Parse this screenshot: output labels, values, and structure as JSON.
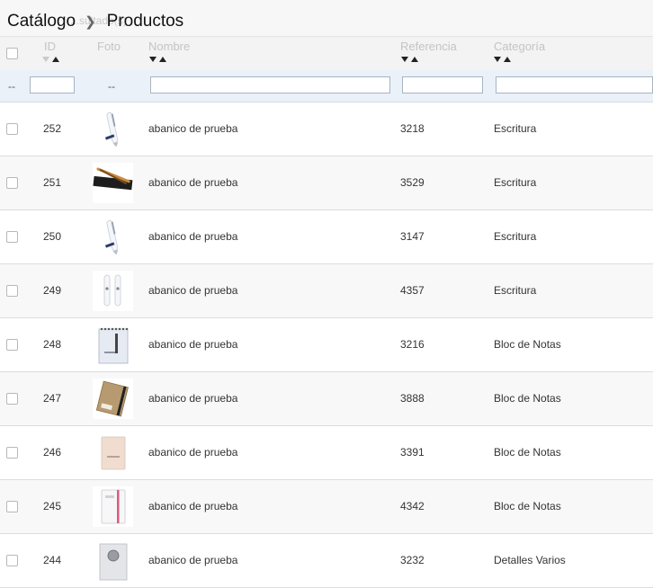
{
  "breadcrumb": {
    "parent": "Catálogo",
    "current": "Productos"
  },
  "list_info": {
    "count_text": "...sultado(s)"
  },
  "columns": {
    "id": "ID",
    "photo": "Foto",
    "name": "Nombre",
    "reference": "Referencia",
    "category": "Categoría"
  },
  "filters": {
    "id_dash": "--",
    "photo_dash": "--"
  },
  "products": [
    {
      "id": "252",
      "name": "abanico de prueba",
      "reference": "3218",
      "category": "Escritura",
      "thumb": "pen-white"
    },
    {
      "id": "251",
      "name": "abanico de prueba",
      "reference": "3529",
      "category": "Escritura",
      "thumb": "pen-set-black-box"
    },
    {
      "id": "250",
      "name": "abanico de prueba",
      "reference": "3147",
      "category": "Escritura",
      "thumb": "pen-white"
    },
    {
      "id": "249",
      "name": "abanico de prueba",
      "reference": "4357",
      "category": "Escritura",
      "thumb": "pen-pair"
    },
    {
      "id": "248",
      "name": "abanico de prueba",
      "reference": "3216",
      "category": "Bloc de Notas",
      "thumb": "spiral-notepad"
    },
    {
      "id": "247",
      "name": "abanico de prueba",
      "reference": "3888",
      "category": "Bloc de Notas",
      "thumb": "kraft-notebook"
    },
    {
      "id": "246",
      "name": "abanico de prueba",
      "reference": "3391",
      "category": "Bloc de Notas",
      "thumb": "beige-notebook"
    },
    {
      "id": "245",
      "name": "abanico de prueba",
      "reference": "4342",
      "category": "Bloc de Notas",
      "thumb": "white-notebook-pink-band"
    },
    {
      "id": "244",
      "name": "abanico de prueba",
      "reference": "3232",
      "category": "Detalles Varios",
      "thumb": "gift-medallion"
    }
  ]
}
